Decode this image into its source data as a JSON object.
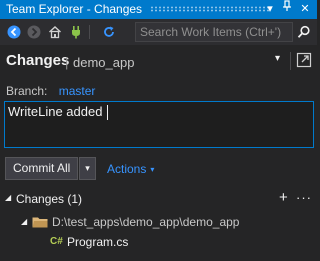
{
  "window": {
    "title": "Team Explorer - Changes",
    "buttons": {
      "dropdown_glyph": "▾",
      "pin_glyph": "ᛘ",
      "close_glyph": "✕"
    }
  },
  "toolbar": {
    "icons": [
      "back-icon",
      "forward-icon",
      "home-icon",
      "connect-icon",
      "refresh-icon"
    ],
    "search": {
      "placeholder": "Search Work Items (Ctrl+')",
      "value": ""
    },
    "search_icon": "search-icon"
  },
  "header": {
    "title": "Changes",
    "separator": "|",
    "repo": "demo_app",
    "menu_glyph": "▾"
  },
  "branch": {
    "label": "Branch:",
    "name": "master"
  },
  "commit": {
    "message": "WriteLine added",
    "button_label": "Commit All",
    "button_dropdown_glyph": "▾",
    "actions_label": "Actions",
    "actions_caret": "▾"
  },
  "changes": {
    "toggle_glyph": "◢",
    "title": "Changes (1)",
    "add_glyph": "+",
    "more_glyph": "···",
    "folder": {
      "toggle_glyph": "◢",
      "path": "D:\\test_apps\\demo_app\\demo_app"
    },
    "files": [
      {
        "type_badge": "C#",
        "name": "Program.cs"
      }
    ]
  },
  "colors": {
    "accent": "#007acc",
    "background": "#252526",
    "toolbar": "#2d2d30",
    "link": "#3794ff",
    "csharp_icon": "#b5ce56",
    "folder": "#dcb67a"
  }
}
